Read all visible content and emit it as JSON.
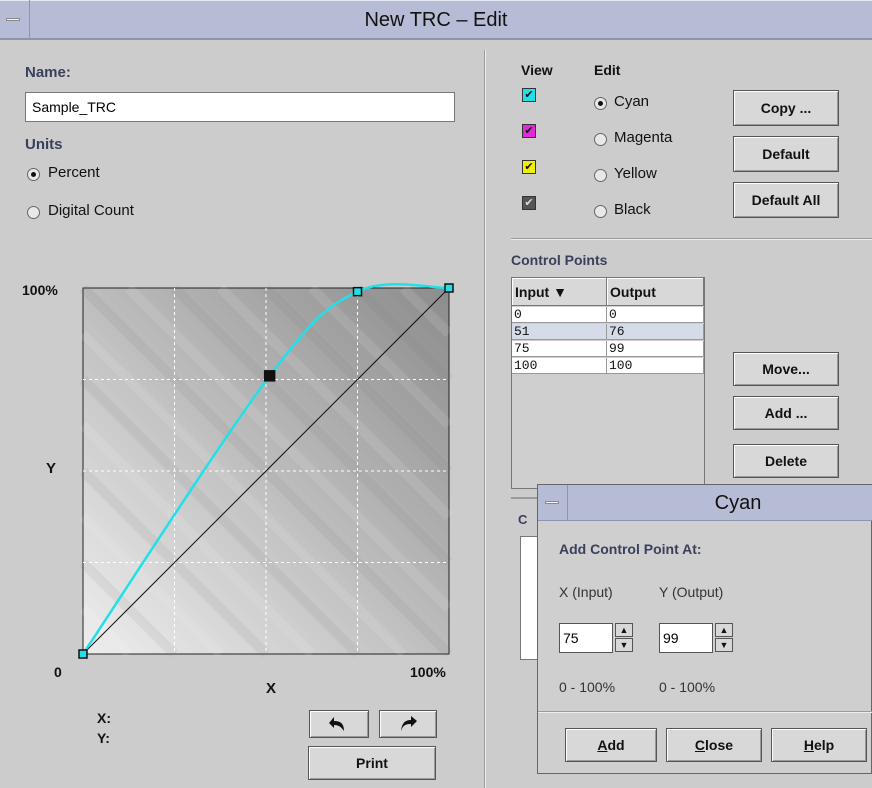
{
  "window": {
    "title": "New TRC – Edit"
  },
  "left": {
    "name_label": "Name:",
    "name_value": "Sample_TRC",
    "units_label": "Units",
    "units_options": [
      "Percent",
      "Digital Count"
    ],
    "units_selected": "Percent"
  },
  "graph": {
    "y_max_label": "100%",
    "y_axis_label": "Y",
    "origin_label": "0",
    "x_max_label": "100%",
    "x_axis_label": "X",
    "x_readout_label": "X:",
    "y_readout_label": "Y:",
    "curve_color": "#22e0e8",
    "points": [
      {
        "input": 0,
        "output": 0
      },
      {
        "input": 51,
        "output": 76
      },
      {
        "input": 75,
        "output": 99
      },
      {
        "input": 100,
        "output": 100
      }
    ],
    "selected_point_index": 1
  },
  "buttons": {
    "undo_icon": "undo-arrow-icon",
    "redo_icon": "redo-arrow-icon",
    "print": "Print",
    "copy": "Copy ...",
    "default": "Default",
    "default_all": "Default All",
    "move": "Move...",
    "add": "Add ...",
    "delete": "Delete"
  },
  "view_edit": {
    "view_label": "View",
    "edit_label": "Edit",
    "channels": [
      {
        "name": "Cyan",
        "color": "#22e0e8",
        "checked": true
      },
      {
        "name": "Magenta",
        "color": "#e02bd8",
        "checked": true
      },
      {
        "name": "Yellow",
        "color": "#f0f000",
        "checked": true
      },
      {
        "name": "Black",
        "color": "#555555",
        "checked": true
      }
    ],
    "edit_selected": "Cyan"
  },
  "control_points": {
    "label": "Control Points",
    "columns": [
      "Input ▼",
      "Output"
    ],
    "rows": [
      [
        "0",
        "0"
      ],
      [
        "51",
        "76"
      ],
      [
        "75",
        "99"
      ],
      [
        "100",
        "100"
      ]
    ],
    "selected_row": 1,
    "partial_label": "C"
  },
  "dialog": {
    "title": "Cyan",
    "heading": "Add Control Point At:",
    "x_label": "X (Input)",
    "y_label": "Y (Output)",
    "x_value": "75",
    "y_value": "99",
    "x_range": "0 - 100%",
    "y_range": "0 - 100%",
    "add_accel": "A",
    "add_rest": "dd",
    "close_accel": "C",
    "close_rest": "lose",
    "help_accel": "H",
    "help_rest": "elp"
  }
}
